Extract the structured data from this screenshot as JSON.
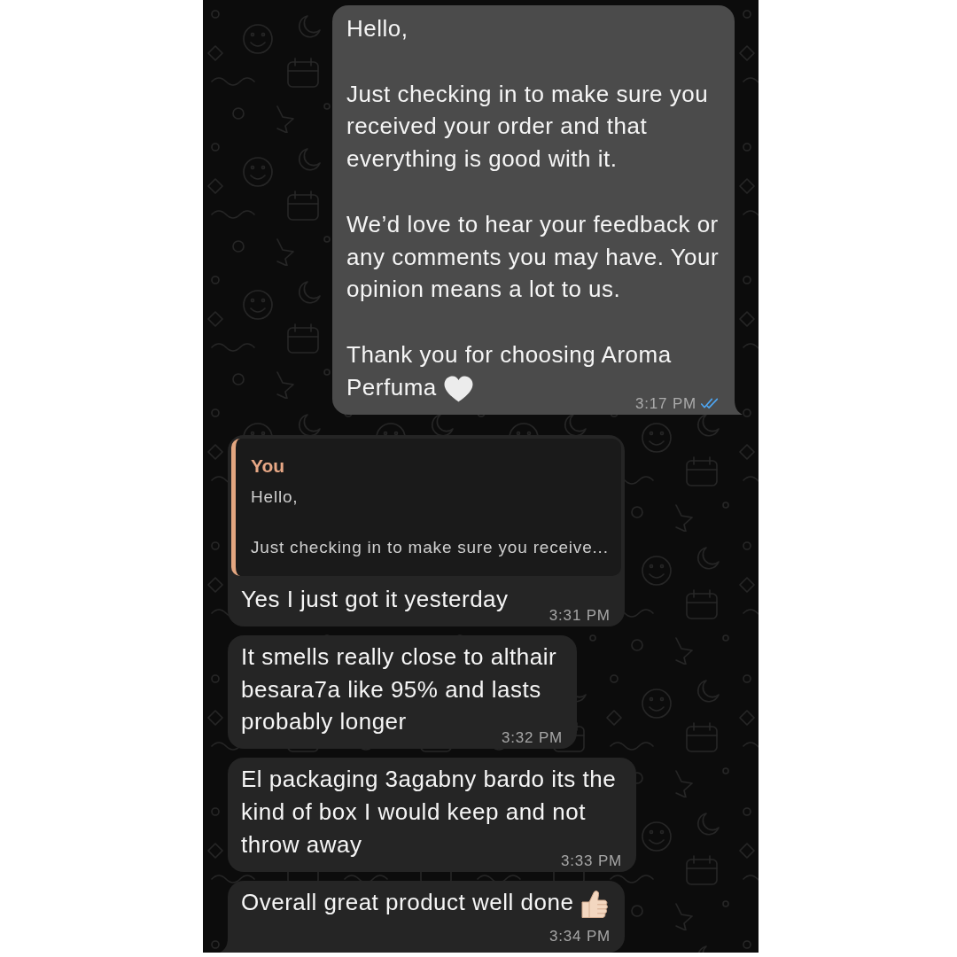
{
  "messages": [
    {
      "kind": "outgoing",
      "text": "Hello,\n\nJust checking in to make sure you received your order and that everything is good with it.\n\nWe’d love to hear your feedback or any comments you may have. Your opinion means a lot to us.\n\nThank you for choosing Aroma Perfuma",
      "emoji": {
        "kind": "white_heart"
      },
      "time": "3:17 PM",
      "read": true,
      "tail": true
    },
    {
      "kind": "incoming",
      "quote": {
        "author": "You",
        "text": "Hello,\n\nJust checking in to make sure you receive..."
      },
      "text": "Yes I just got it yesterday",
      "time": "3:31 PM",
      "tail": false
    },
    {
      "kind": "incoming",
      "text": "It smells really close to althair besara7a like 95% and lasts probably longer",
      "time": "3:32 PM",
      "tail": false
    },
    {
      "kind": "incoming",
      "text": "El packaging 3agabny bardo its the kind of box I would keep and not throw away",
      "time": "3:33 PM",
      "tail": false
    },
    {
      "kind": "incoming",
      "text": "Overall great product well done",
      "emoji": {
        "kind": "thumbs_up"
      },
      "time": "3:34 PM",
      "tail": true
    }
  ]
}
